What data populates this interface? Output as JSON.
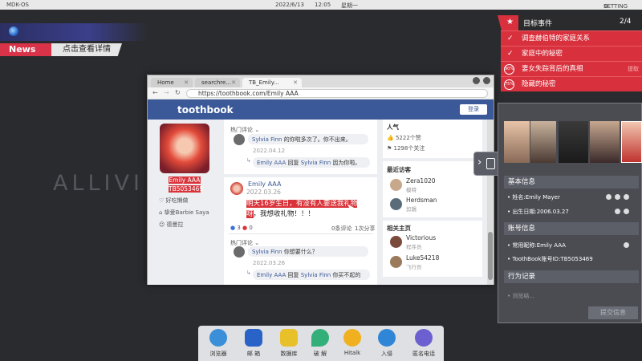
{
  "topbar": {
    "os": "MDK-OS",
    "date": "2022/6/13",
    "time": "12:05",
    "weekday": "星期一",
    "settings": "SETTING"
  },
  "desktop": {
    "bg_text": "ALLIVI"
  },
  "news": {
    "tag": "News",
    "link": "点击查看详情"
  },
  "browser": {
    "tabs": [
      {
        "label": "Home"
      },
      {
        "label": "searchre..."
      },
      {
        "label": "TB_Emily..."
      }
    ],
    "url": "https://toothbook.com/Emily AAA",
    "logo": "toothbook",
    "login": "登录",
    "profile": {
      "name": "Emily AAA",
      "id": "TB5053469",
      "details": [
        "好吃懒做",
        "挚爱Barbie Saya",
        "德曼拉"
      ]
    },
    "post1": {
      "hot_label": "热门评论",
      "c1_author": "Sylvia Finn",
      "c1_text": "的你啦多次了。你不出来。",
      "c1_date": "2022.04.12",
      "r1_author": "Emily AAA",
      "r1_mid": "回复",
      "r1_target": "Sylvia Finn",
      "r1_text": "因为你啦。"
    },
    "post2": {
      "author": "Emily AAA",
      "date": "2022.03.26",
      "text_highlight": "明天16岁生日，有没有人要送我礼物呀",
      "text_rest": "，我想收礼物！！！",
      "likes": "3",
      "dislikes": "0",
      "comments": "0条评论",
      "shares": "1次分享",
      "hot_label": "热门评论",
      "c1_author": "Sylvia Finn",
      "c1_text": "你想要什么？",
      "c1_date": "2022.03.26",
      "r1_author": "Emily AAA",
      "r1_mid": "回复",
      "r1_target": "Sylvia Finn",
      "r1_text": "你买不起的"
    },
    "side": {
      "popularity_title": "人气",
      "likes": "5222个赞",
      "follows": "1298个关注",
      "visitors_title": "最近访客",
      "visitors": [
        {
          "name": "Zera1020",
          "role": "模特"
        },
        {
          "name": "Herdsman",
          "role": "剪辑"
        }
      ],
      "related_title": "相关主页",
      "related": [
        {
          "name": "Victorious",
          "role": "程序员"
        },
        {
          "name": "Luke54218",
          "role": "飞行员"
        }
      ]
    }
  },
  "objectives": {
    "title": "目标事件",
    "progress": "2/4",
    "items": [
      {
        "label": "调查赫伯特的家庭关系",
        "status": "done"
      },
      {
        "label": "家庭中的秘密",
        "status": "done"
      },
      {
        "label": "妻女失踪背后的真相",
        "status": "90%",
        "extra": "提取"
      },
      {
        "label": "隐藏的秘密",
        "status": "75%"
      }
    ]
  },
  "info": {
    "basic_title": "基本信息",
    "name": "• 姓名:Emily Mayer",
    "dob": "• 出生日期:2006.03.27",
    "account_title": "账号信息",
    "nickname": "• 常用昵称:Emily AAA",
    "tb_id": "• ToothBook账号ID:TB5053469",
    "record_title": "行为记录",
    "record_item": "• 浏览结...",
    "submit": "提交信息"
  },
  "dock": [
    {
      "label": "浏览器",
      "color": "#3a8fd8"
    },
    {
      "label": "邮 箱",
      "color": "#2a63c7"
    },
    {
      "label": "数据库",
      "color": "#e8c02a"
    },
    {
      "label": "破 解",
      "color": "#33b07a"
    },
    {
      "label": "Hitalk",
      "color": "#f0b020"
    },
    {
      "label": "入侵",
      "color": "#2f86d6"
    },
    {
      "label": "匿名电话",
      "color": "#6c5fd0"
    }
  ]
}
